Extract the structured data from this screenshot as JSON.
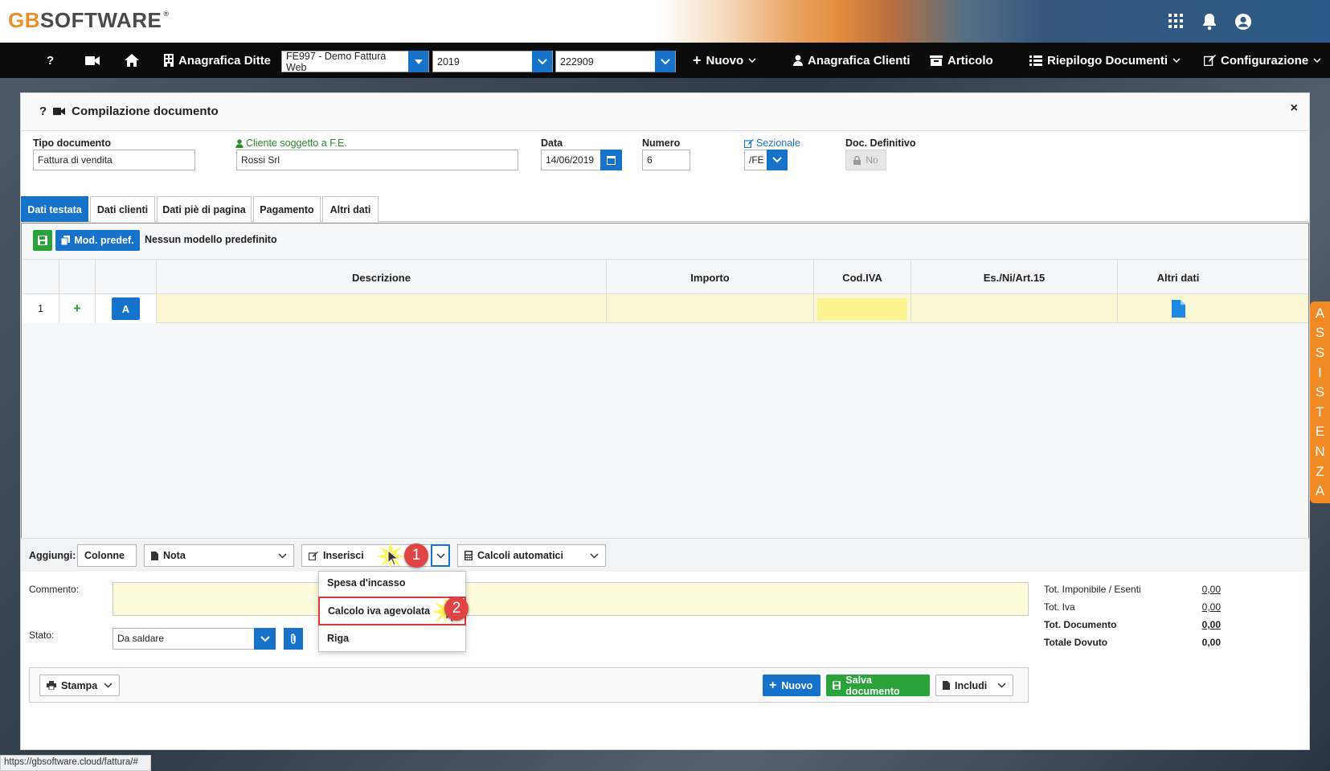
{
  "header": {
    "logo_prefix": "GB",
    "logo_text": "SOFTWARE",
    "logo_tm": "®"
  },
  "nav": {
    "help": "?",
    "anagrafica_ditte": "Anagrafica Ditte",
    "company_select": "FE997 - Demo Fattura Web",
    "year_select": "2019",
    "code_select": "222909",
    "nuovo": "Nuovo",
    "anagrafica_clienti": "Anagrafica Clienti",
    "articolo": "Articolo",
    "riepilogo": "Riepilogo Documenti",
    "configurazione": "Configurazione"
  },
  "panel": {
    "help": "?",
    "title": "Compilazione documento",
    "close": "×",
    "fields": {
      "tipo_label": "Tipo documento",
      "tipo_value": "Fattura di vendita",
      "cliente_label": "Cliente soggetto a F.E.",
      "cliente_value": "Rossi Srl",
      "data_label": "Data",
      "data_value": "14/06/2019",
      "numero_label": "Numero",
      "numero_value": "6",
      "sezionale_label": "Sezionale",
      "sezionale_value": "/FE",
      "definitivo_label": "Doc. Definitivo",
      "definitivo_value": "No"
    },
    "tabs": [
      "Dati testata",
      "Dati clienti",
      "Dati piè di pagina",
      "Pagamento",
      "Altri dati"
    ],
    "grid": {
      "mod_button": "Mod. predef.",
      "mod_text": "Nessun modello predefinito",
      "columns": [
        "",
        "",
        "",
        "Descrizione",
        "Importo",
        "Cod.IVA",
        "Es./Ni/Art.15",
        "Altri dati"
      ],
      "rows": [
        {
          "num": "1",
          "add": "+",
          "type": "A"
        }
      ]
    },
    "addbar": {
      "label": "Aggiungi:",
      "colonne": "Colonne",
      "nota": "Nota",
      "inserisci": "Inserisci",
      "calcoli": "Calcoli automatici"
    },
    "menu": {
      "items": [
        "Spesa d'incasso",
        "Calcolo iva agevolata",
        "Riga"
      ]
    },
    "callouts": [
      "1",
      "2"
    ],
    "commento_label": "Commento:",
    "stato_label": "Stato:",
    "stato_value": "Da saldare",
    "totals": [
      {
        "label": "Tot. Imponibile / Esenti",
        "value": "0,00"
      },
      {
        "label": "Tot. Iva",
        "value": "0,00"
      },
      {
        "label": "Tot. Documento",
        "value": "0,00"
      },
      {
        "label": "Totale Dovuto",
        "value": "0,00"
      }
    ],
    "footer": {
      "stampa": "Stampa",
      "nuovo": "Nuovo",
      "salva": "Salva documento",
      "includi": "Includi"
    }
  },
  "assistenza": [
    "A",
    "S",
    "S",
    "I",
    "S",
    "T",
    "E",
    "N",
    "Z",
    "A"
  ],
  "status_url": "https://gbsoftware.cloud/fattura/#",
  "colors": {
    "primary": "#1673c9",
    "success": "#2aa33a",
    "accent": "#f08a24",
    "callout": "#e04444",
    "highlight": "#fbf6d4"
  }
}
